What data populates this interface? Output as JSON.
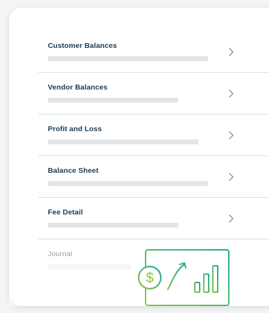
{
  "reports": [
    {
      "label": "Customer Balances"
    },
    {
      "label": "Vendor Balances"
    },
    {
      "label": "Profit and Loss"
    },
    {
      "label": "Balance Sheet"
    },
    {
      "label": "Fee Detail"
    },
    {
      "label": "Journal"
    }
  ],
  "icons": {
    "row_action": "chevron-right-icon",
    "illustration": "financial-growth-icon"
  },
  "colors": {
    "label_text": "#1e3a52",
    "divider": "#cfe6ee",
    "chevron": "#8a9096",
    "illustration_gradient": [
      "#8cc63f",
      "#1aa99d"
    ]
  }
}
